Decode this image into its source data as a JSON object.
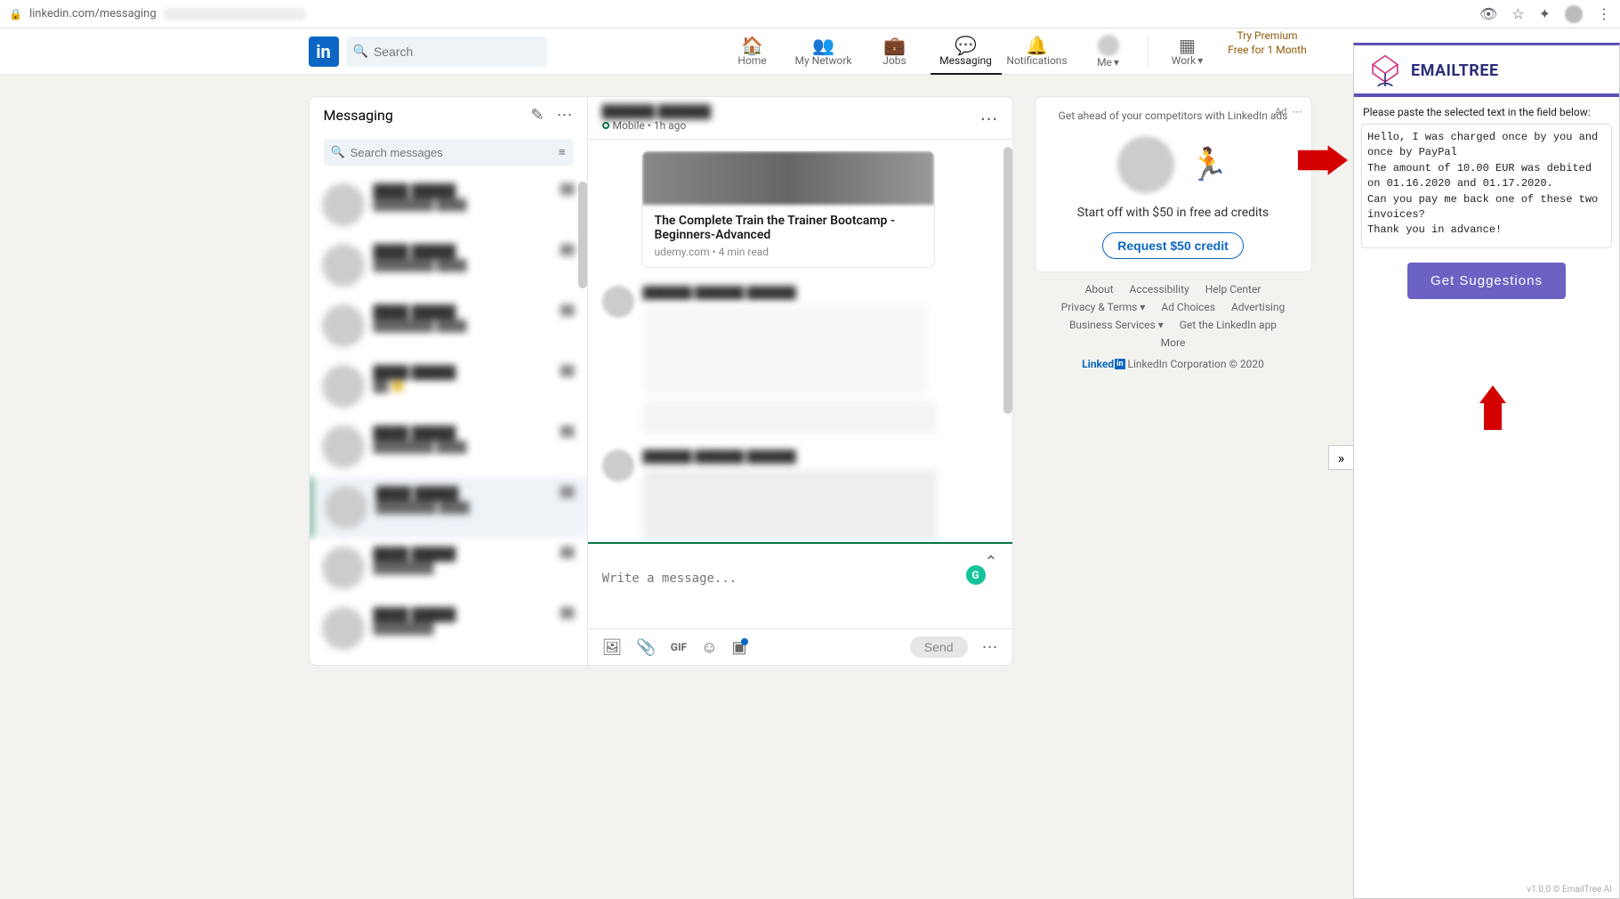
{
  "chrome": {
    "url": "linkedin.com/messaging"
  },
  "topnav": {
    "search_placeholder": "Search",
    "home": "Home",
    "network": "My Network",
    "jobs": "Jobs",
    "messaging": "Messaging",
    "notifications": "Notifications",
    "me": "Me",
    "work": "Work",
    "premium": "Try Premium Free for 1 Month"
  },
  "messaging": {
    "title": "Messaging",
    "search_placeholder": "Search messages",
    "status_line": "Mobile  •  1h ago",
    "article": {
      "title": "The Complete Train the Trainer Bootcamp - Beginners-Advanced",
      "meta": "udemy.com • 4 min read"
    },
    "compose_placeholder": "Write a message...",
    "send_label": "Send",
    "gif_label": "GIF"
  },
  "ad": {
    "label": "Ad",
    "headline": "Get ahead of your competitors with LinkedIn ads",
    "line": "Start off with $50 in free ad credits",
    "button": "Request $50 credit"
  },
  "footer": {
    "about": "About",
    "accessibility": "Accessibility",
    "help": "Help Center",
    "privacy": "Privacy & Terms",
    "adchoices": "Ad Choices",
    "advertising": "Advertising",
    "business": "Business Services",
    "getapp": "Get the LinkedIn app",
    "more": "More",
    "corp": "LinkedIn Corporation © 2020",
    "linked": "Linked"
  },
  "emailtree": {
    "brand": "EMAILTREE",
    "instruction": "Please paste the selected text in the field below:",
    "text": "Hello, I was charged once by you and once by PayPal\nThe amount of 10.00 EUR was debited on 01.16.2020 and 01.17.2020.\nCan you pay me back one of these two invoices?\nThank you in advance!",
    "button": "Get Suggestions",
    "version": "v1.0.0  © EmailTree AI"
  }
}
